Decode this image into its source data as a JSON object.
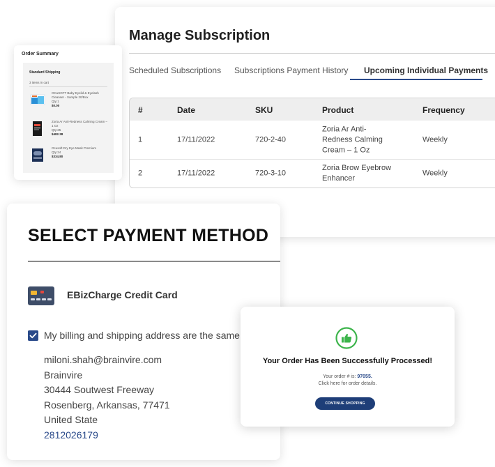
{
  "subscription": {
    "title": "Manage Subscription",
    "tabs": [
      "Scheduled Subscriptions",
      "Subscriptions Payment History",
      "Upcoming Individual Payments"
    ],
    "columns": [
      "#",
      "Date",
      "SKU",
      "Product",
      "Frequency"
    ],
    "rows": [
      {
        "num": "1",
        "date": "17/11/2022",
        "sku": "720-2-40",
        "product": "Zoria Ar Anti-Redness Calming Cream – 1 Oz",
        "frequency": "Weekly"
      },
      {
        "num": "2",
        "date": "17/11/2022",
        "sku": "720-3-10",
        "product": "Zoria Brow Eyebrow Enhancer",
        "frequency": "Weekly"
      }
    ]
  },
  "order_summary": {
    "title": "Order Summary",
    "shipping": "Standard Shipping",
    "count": "3 items in cart",
    "items": [
      {
        "name": "OCuSOFT Baby Eyelid & Eyelash Cleanser - Sample 20/Box",
        "qty": "Qty:1",
        "price": "$0.00"
      },
      {
        "name": "Zoria Ar Anti-Redness Calming Cream – 1 Oz",
        "qty": "Qty:25",
        "price": "$482.38"
      },
      {
        "name": "Ocusoft Dry Eye Mask Premium",
        "qty": "Qty:24",
        "price": "$334.80"
      }
    ]
  },
  "payment": {
    "title": "SELECT PAYMENT METHOD",
    "method": "EBizCharge Credit Card",
    "checkbox_label": "My billing and shipping address are the same",
    "address": {
      "email": "miloni.shah@brainvire.com",
      "company": "Brainvire",
      "street": "30444 Soutwest Freeway",
      "city": "Rosenberg, Arkansas, 77471",
      "country": "United State",
      "phone": "2812026179"
    }
  },
  "success": {
    "heading": "Your Order Has Been Successfully Processed!",
    "order_prefix": "Your order # is:",
    "order_number": "97055.",
    "details_link": "Click here for order details.",
    "button": "CONTINUE SHOPPING"
  },
  "colors": {
    "accent": "#2a4a8a",
    "button": "#1e3e78",
    "success_green": "#3cb44b"
  }
}
